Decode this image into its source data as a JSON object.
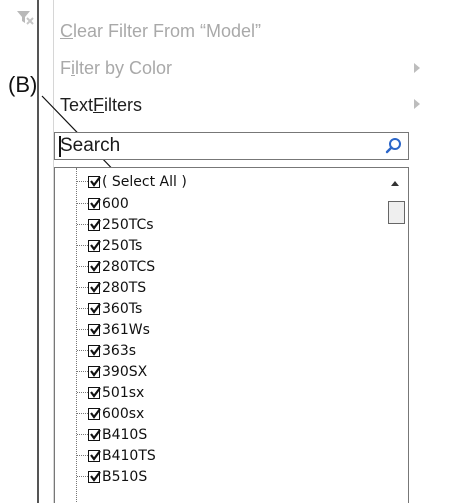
{
  "menu": {
    "clear_filter": {
      "pre": "",
      "accel": "C",
      "post": "lear Filter From “Model”"
    },
    "filter_by_color": {
      "pre": "F",
      "accel": "i",
      "post": "lter by Color"
    },
    "text_filters": {
      "pre": "Text ",
      "accel": "F",
      "post": "ilters"
    }
  },
  "annotation": {
    "label": "(B)"
  },
  "search": {
    "value": "Search",
    "icon": "search-icon"
  },
  "list": {
    "items": [
      {
        "label": "( Select All )",
        "checked": true
      },
      {
        "label": "600",
        "checked": true
      },
      {
        "label": "250TCs",
        "checked": true
      },
      {
        "label": "250Ts",
        "checked": true
      },
      {
        "label": "280TCS",
        "checked": true
      },
      {
        "label": "280TS",
        "checked": true
      },
      {
        "label": "360Ts",
        "checked": true
      },
      {
        "label": "361Ws",
        "checked": true
      },
      {
        "label": "363s",
        "checked": true
      },
      {
        "label": "390SX",
        "checked": true
      },
      {
        "label": "501sx",
        "checked": true
      },
      {
        "label": "600sx",
        "checked": true
      },
      {
        "label": "B410S",
        "checked": true
      },
      {
        "label": "B410TS",
        "checked": true
      },
      {
        "label": "B510S",
        "checked": true
      }
    ]
  },
  "icons": {
    "clear_filter": "clear-filter-icon",
    "submenu": "chevron-right-icon",
    "checkmark": "checkmark-icon",
    "scroll_up": "scroll-up-icon"
  },
  "colors": {
    "menu_disabled_text": "#a9a9a9",
    "menu_enabled_text": "#1e1e1e",
    "accent_icon": "#2b66c9"
  }
}
